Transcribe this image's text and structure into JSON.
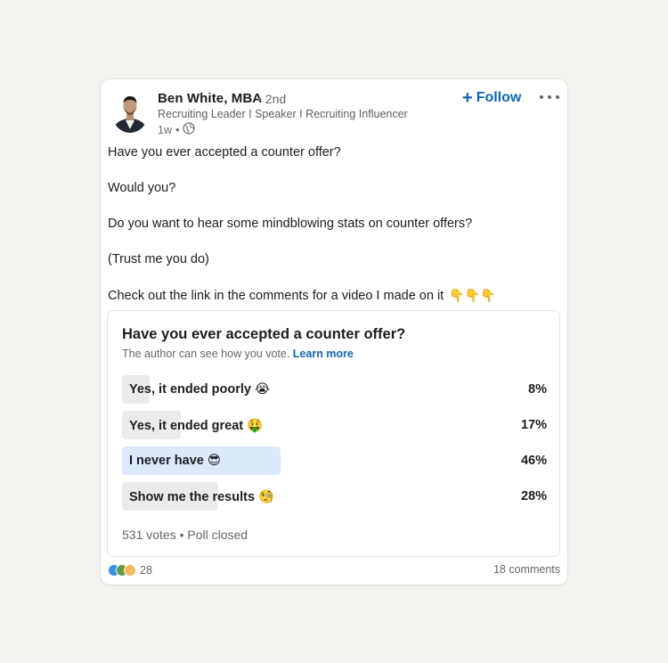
{
  "post": {
    "author_name": "Ben White, MBA",
    "degree": "• 2nd",
    "headline": "Recruiting Leader I Speaker I Recruiting Influencer",
    "time": "1w",
    "visibility_separator": "•",
    "follow_label": "Follow",
    "more_label": "•••",
    "text_lines": [
      "Have you ever accepted a counter offer?",
      "Would you?",
      "Do you want to hear some mindblowing stats on counter offers?",
      "(Trust me you do)",
      "Check out the link in the comments for a video I made on it"
    ],
    "trailing_emoji": "👇👇👇"
  },
  "poll": {
    "question": "Have you ever accepted a counter offer?",
    "subtitle": "The author can see how you vote.",
    "learn_more": "Learn more",
    "options": [
      {
        "label": "Yes, it ended poorly 😭",
        "percent": "8%",
        "value": 8,
        "selected": false
      },
      {
        "label": "Yes, it ended great 🤑",
        "percent": "17%",
        "value": 17,
        "selected": false
      },
      {
        "label": "I never have 😎",
        "percent": "46%",
        "value": 46,
        "selected": true
      },
      {
        "label": "Show me the results 🧐",
        "percent": "28%",
        "value": 28,
        "selected": false
      }
    ],
    "footer": "531 votes • Poll closed"
  },
  "social": {
    "reaction_count": "28",
    "comments": "18 comments"
  },
  "colors": {
    "accent": "#0a66c2",
    "selected_bar": "#dce9fb",
    "bar": "#ebebeb"
  }
}
